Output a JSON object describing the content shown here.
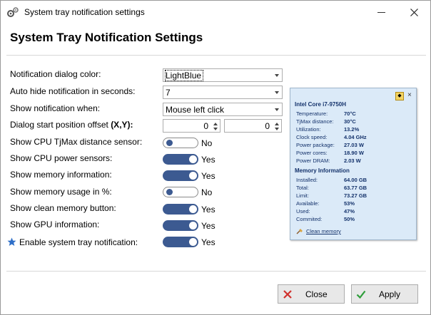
{
  "window": {
    "title": "System tray notification settings"
  },
  "heading": "System Tray Notification Settings",
  "rows": {
    "dialog_color": {
      "label": "Notification dialog color:",
      "value": "LightBlue"
    },
    "auto_hide": {
      "label": "Auto hide notification in seconds:",
      "value": "7"
    },
    "show_when": {
      "label": "Show notification when:",
      "value": "Mouse left click"
    },
    "offset": {
      "label": "Dialog start position offset ",
      "label_bold": "(X,Y):",
      "x": "0",
      "y": "0"
    },
    "cpu_tjmax": {
      "label": "Show CPU TjMax distance sensor:",
      "state": "No",
      "on": false
    },
    "cpu_power": {
      "label": "Show CPU power sensors:",
      "state": "Yes",
      "on": true
    },
    "memory_info": {
      "label": "Show memory information:",
      "state": "Yes",
      "on": true
    },
    "memory_pct": {
      "label": "Show memory usage in %:",
      "state": "No",
      "on": false
    },
    "clean_memory": {
      "label": "Show clean memory button:",
      "state": "Yes",
      "on": true
    },
    "gpu_info": {
      "label": "Show GPU information:",
      "state": "Yes",
      "on": true
    },
    "enable_tray": {
      "label": "Enable system tray notification:",
      "state": "Yes",
      "on": true
    }
  },
  "preview": {
    "cpu_title": "Intel Core i7-9750H",
    "cpu": [
      {
        "k": "Temperature:",
        "v": "70°C"
      },
      {
        "k": "TjMax distance:",
        "v": "30°C"
      },
      {
        "k": "Utilization:",
        "v": "13.2%"
      },
      {
        "k": "Clock speed:",
        "v": "4.04 GHz"
      },
      {
        "k": "Power package:",
        "v": "27.03 W"
      },
      {
        "k": "Power cores:",
        "v": "18.90 W"
      },
      {
        "k": "Power DRAM:",
        "v": "2.03 W"
      }
    ],
    "mem_title": "Memory Information",
    "mem": [
      {
        "k": "Installed:",
        "v": "64.00 GB"
      },
      {
        "k": "Total:",
        "v": "63.77 GB"
      },
      {
        "k": "Limit:",
        "v": "73.27 GB"
      },
      {
        "k": "Available:",
        "v": "53%"
      },
      {
        "k": "Used:",
        "v": "47%"
      },
      {
        "k": "Commited:",
        "v": "50%"
      }
    ],
    "clean_link": "Clean memory"
  },
  "buttons": {
    "close": "Close",
    "apply": "Apply"
  },
  "colors": {
    "accent": "#3c5a91",
    "preview_bg": "#dbeaf8",
    "preview_text": "#14326b",
    "star": "#2f6fc8"
  },
  "icons": {
    "title": "gears-icon",
    "star": "star-icon",
    "close_btn": "red-x-icon",
    "apply_btn": "green-check-icon",
    "pin": "pin-icon",
    "broom": "broom-icon"
  }
}
